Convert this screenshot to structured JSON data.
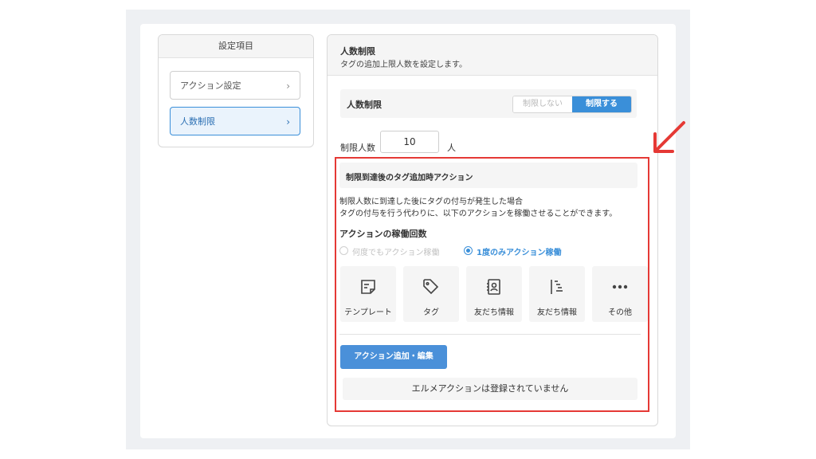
{
  "sidebar": {
    "header": "設定項目",
    "items": [
      {
        "label": "アクション設定",
        "chevron": "›"
      },
      {
        "label": "人数制限",
        "chevron": "›"
      }
    ]
  },
  "main": {
    "title": "人数制限",
    "subtitle": "タグの追加上限人数を設定します。",
    "limit_row": {
      "label": "人数制限",
      "toggle_off": "制限しない",
      "toggle_on": "制限する"
    },
    "count": {
      "label": "制限人数",
      "value": "10",
      "unit": "人"
    },
    "action_section": {
      "header": "制限到達後のタグ追加時アクション",
      "desc_line1": "制限人数に到達した後にタグの付与が発生した場合",
      "desc_line2": "タグの付与を行う代わりに、以下のアクションを稼働させることができます。",
      "run_count_title": "アクションの稼働回数",
      "radio_options": [
        {
          "label": "何度でもアクション稼働",
          "selected": false
        },
        {
          "label": "1度のみアクション稼働",
          "selected": true
        }
      ],
      "tiles": [
        {
          "label": "テンプレート",
          "icon": "template-icon"
        },
        {
          "label": "タグ",
          "icon": "tag-icon"
        },
        {
          "label": "友だち情報",
          "icon": "contact-book-icon"
        },
        {
          "label": "友だち情報",
          "icon": "list-indent-icon"
        },
        {
          "label": "その他",
          "icon": "more-icon"
        }
      ],
      "add_button": "アクション追加・編集",
      "empty_message": "エルメアクションは登録されていません"
    }
  },
  "colors": {
    "accent": "#3a8fd9",
    "highlight_red": "#e53935"
  }
}
